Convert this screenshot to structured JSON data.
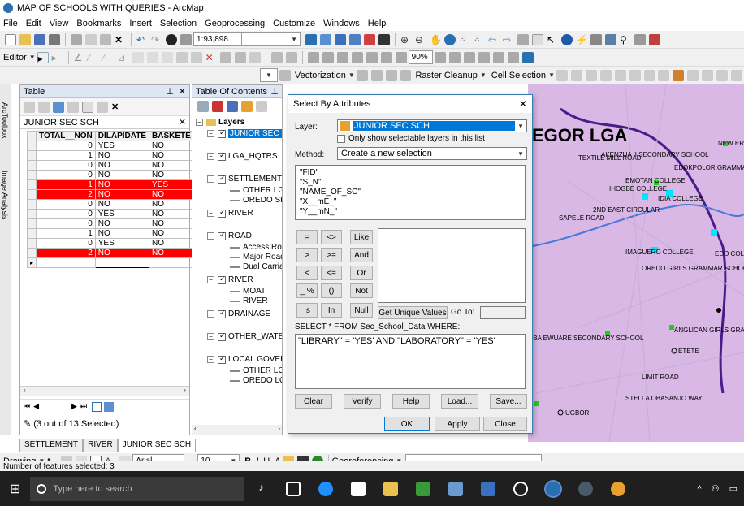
{
  "window": {
    "title": "MAP OF SCHOOLS WITH QUERIES - ArcMap"
  },
  "menu": [
    "File",
    "Edit",
    "View",
    "Bookmarks",
    "Insert",
    "Selection",
    "Geoprocessing",
    "Customize",
    "Windows",
    "Help"
  ],
  "toolbar": {
    "scale": "1:93,898",
    "editor": "Editor",
    "zoom_pct": "90%",
    "vectorization": "Vectorization",
    "raster_cleanup": "Raster Cleanup",
    "cell_selection": "Cell Selection"
  },
  "table": {
    "title": "Table",
    "tab_name": "JUNIOR SEC SCH",
    "columns": [
      "TOTAL__NON",
      "DILAPIDATE",
      "BASKETE"
    ],
    "rows": [
      {
        "n": "0",
        "d": "YES",
        "b": "NO",
        "sel": false
      },
      {
        "n": "1",
        "d": "NO",
        "b": "NO",
        "sel": false
      },
      {
        "n": "0",
        "d": "NO",
        "b": "NO",
        "sel": false
      },
      {
        "n": "0",
        "d": "NO",
        "b": "NO",
        "sel": false
      },
      {
        "n": "1",
        "d": "NO",
        "b": "YES",
        "sel": true
      },
      {
        "n": "2",
        "d": "NO",
        "b": "NO",
        "sel": true
      },
      {
        "n": "0",
        "d": "NO",
        "b": "NO",
        "sel": false
      },
      {
        "n": "0",
        "d": "YES",
        "b": "NO",
        "sel": false
      },
      {
        "n": "0",
        "d": "NO",
        "b": "NO",
        "sel": false
      },
      {
        "n": "1",
        "d": "NO",
        "b": "NO",
        "sel": false
      },
      {
        "n": "0",
        "d": "YES",
        "b": "NO",
        "sel": false
      },
      {
        "n": "2",
        "d": "NO",
        "b": "NO",
        "sel": true
      }
    ],
    "selected_status": "(3 out of 13 Selected)",
    "bottom_tabs": [
      "SETTLEMENT",
      "RIVER",
      "JUNIOR SEC SCH"
    ]
  },
  "toc": {
    "title": "Table Of Contents",
    "layers_label": "Layers",
    "items": [
      {
        "label": "JUNIOR SEC SC",
        "type": "layer",
        "highlight": true
      },
      {
        "label": "LGA_HQTRS",
        "type": "layer"
      },
      {
        "label": "SETTLEMENT",
        "type": "layer"
      },
      {
        "label": "OTHER LGA",
        "type": "legend"
      },
      {
        "label": "OREDO SET",
        "type": "legend"
      },
      {
        "label": "RIVER",
        "type": "layer"
      },
      {
        "label": "ROAD",
        "type": "layer"
      },
      {
        "label": "Access Road",
        "type": "legend"
      },
      {
        "label": "Major Road",
        "type": "legend"
      },
      {
        "label": "Dual Carriag",
        "type": "legend"
      },
      {
        "label": "RIVER",
        "type": "layer"
      },
      {
        "label": "MOAT",
        "type": "legend"
      },
      {
        "label": "RIVER",
        "type": "legend"
      },
      {
        "label": "DRAINAGE",
        "type": "layer"
      },
      {
        "label": "OTHER_WATE",
        "type": "layer"
      },
      {
        "label": "LOCAL GOVER",
        "type": "layer"
      },
      {
        "label": "OTHER LOC",
        "type": "legend"
      },
      {
        "label": "OREDO LOC",
        "type": "legend"
      }
    ]
  },
  "dialog": {
    "title": "Select By Attributes",
    "layer_label": "Layer:",
    "layer_value": "JUNIOR SEC SCH",
    "only_selectable": "Only show selectable layers in this list",
    "method_label": "Method:",
    "method_value": "Create a new selection",
    "fields": [
      "\"FID\"",
      "\"S_N\"",
      "\"NAME_OF_SC\"",
      "\"X__mE_\"",
      "\"Y__mN_\""
    ],
    "operators": [
      "=",
      "<>",
      "Like",
      ">",
      ">=",
      "And",
      "<",
      "<=",
      "Or",
      "_ %",
      "()",
      "Not",
      "Is",
      "In",
      "Null"
    ],
    "unique_values": "Get Unique Values",
    "goto": "Go To:",
    "sql_prefix": "SELECT * FROM Sec_School_Data WHERE:",
    "expression": "\"LIBRARY\" = 'YES' AND \"LABORATORY\" = 'YES'",
    "buttons": [
      "Clear",
      "Verify",
      "Help",
      "Load...",
      "Save..."
    ],
    "ok": "OK",
    "apply": "Apply",
    "close": "Close"
  },
  "map": {
    "title": "EGOR LGA",
    "labels": [
      "AKENZUA II SECONDARY SCHOOL",
      "EDOKPOLOR GRAMMAR SCHOOL",
      "EMOTAN COLLEGE",
      "IHOGBE COLLEGE",
      "IDIA COLLEGE",
      "IMAGUERO COLLEGE",
      "OREDO GIRLS GRAMMAR SCHOOL",
      "ANGLICAN GIRLS GRAMMAR SCHOOL",
      "OBA EWUARE SECONDARY SCHOOL",
      "ETETE",
      "UGBOR",
      "STELLA OBASANJO WAY",
      "LIMIT ROAD",
      "NEW ERA COLLEGE",
      "EDO COLLEGE",
      "TEXTILE MILL ROAD",
      "SAPELE ROAD",
      "2ND EAST CIRCULAR"
    ],
    "colors": {
      "land": "#d9b8e6",
      "road": "#c8b0d8",
      "boundary": "#4a1c8a",
      "river": "#4a78d8"
    }
  },
  "drawing": {
    "label": "Drawing",
    "font": "Arial",
    "size": "10",
    "georef": "Georeferencing"
  },
  "status": {
    "features": "Number of features selected: 3"
  },
  "taskbar": {
    "search": "Type here to search"
  }
}
